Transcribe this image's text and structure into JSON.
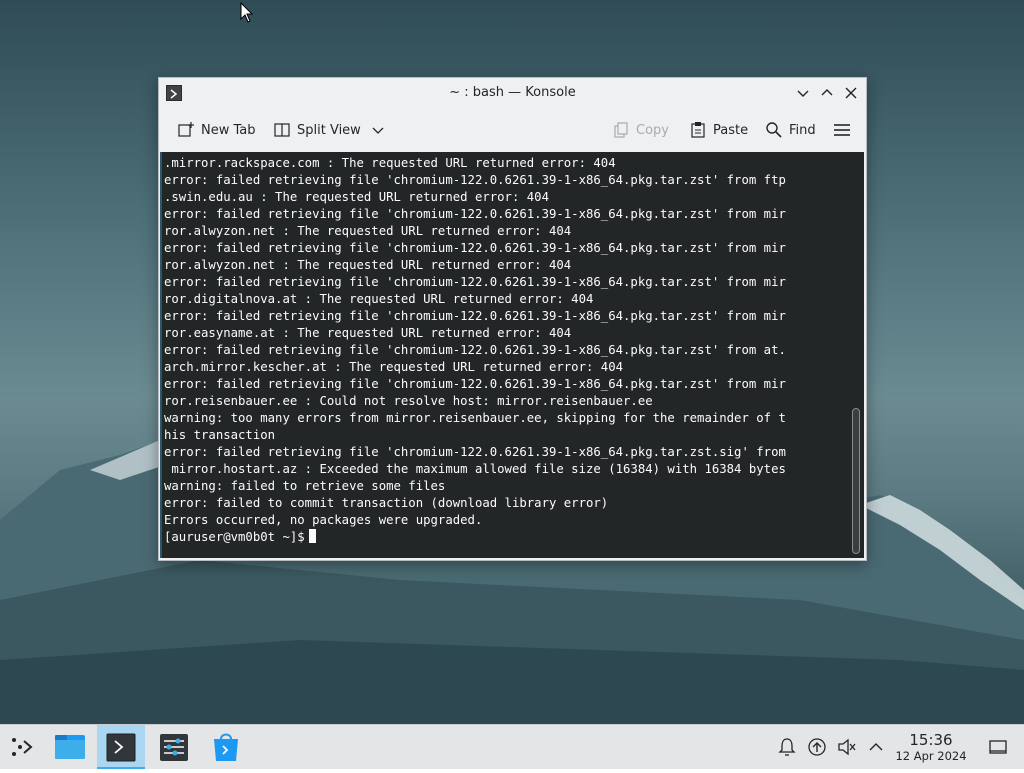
{
  "window": {
    "title": "~ : bash — Konsole",
    "toolbar": {
      "new_tab": "New Tab",
      "split_view": "Split View",
      "copy": "Copy",
      "paste": "Paste",
      "find": "Find"
    }
  },
  "terminal": {
    "lines": [
      ".mirror.rackspace.com : The requested URL returned error: 404",
      "error: failed retrieving file 'chromium-122.0.6261.39-1-x86_64.pkg.tar.zst' from ftp",
      ".swin.edu.au : The requested URL returned error: 404",
      "error: failed retrieving file 'chromium-122.0.6261.39-1-x86_64.pkg.tar.zst' from mir",
      "ror.alwyzon.net : The requested URL returned error: 404",
      "error: failed retrieving file 'chromium-122.0.6261.39-1-x86_64.pkg.tar.zst' from mir",
      "ror.alwyzon.net : The requested URL returned error: 404",
      "error: failed retrieving file 'chromium-122.0.6261.39-1-x86_64.pkg.tar.zst' from mir",
      "ror.digitalnova.at : The requested URL returned error: 404",
      "error: failed retrieving file 'chromium-122.0.6261.39-1-x86_64.pkg.tar.zst' from mir",
      "ror.easyname.at : The requested URL returned error: 404",
      "error: failed retrieving file 'chromium-122.0.6261.39-1-x86_64.pkg.tar.zst' from at.",
      "arch.mirror.kescher.at : The requested URL returned error: 404",
      "error: failed retrieving file 'chromium-122.0.6261.39-1-x86_64.pkg.tar.zst' from mir",
      "ror.reisenbauer.ee : Could not resolve host: mirror.reisenbauer.ee",
      "warning: too many errors from mirror.reisenbauer.ee, skipping for the remainder of t",
      "his transaction",
      "error: failed retrieving file 'chromium-122.0.6261.39-1-x86_64.pkg.tar.zst.sig' from",
      " mirror.hostart.az : Exceeded the maximum allowed file size (16384) with 16384 bytes",
      "warning: failed to retrieve some files",
      "error: failed to commit transaction (download library error)",
      "Errors occurred, no packages were upgraded."
    ],
    "prompt": "[auruser@vm0b0t ~]$"
  },
  "taskbar": {
    "apps": [
      "application-launcher-icon",
      "file-manager-icon",
      "konsole-icon",
      "system-settings-icon",
      "discover-store-icon"
    ],
    "tray": [
      "notifications-icon",
      "updates-icon",
      "volume-muted-icon",
      "tray-expand-icon"
    ],
    "time": "15:36",
    "date": "12 Apr 2024"
  },
  "colors": {
    "accent": "#3daee9",
    "terminal_bg": "#232627",
    "terminal_fg": "#fcfcfc"
  }
}
